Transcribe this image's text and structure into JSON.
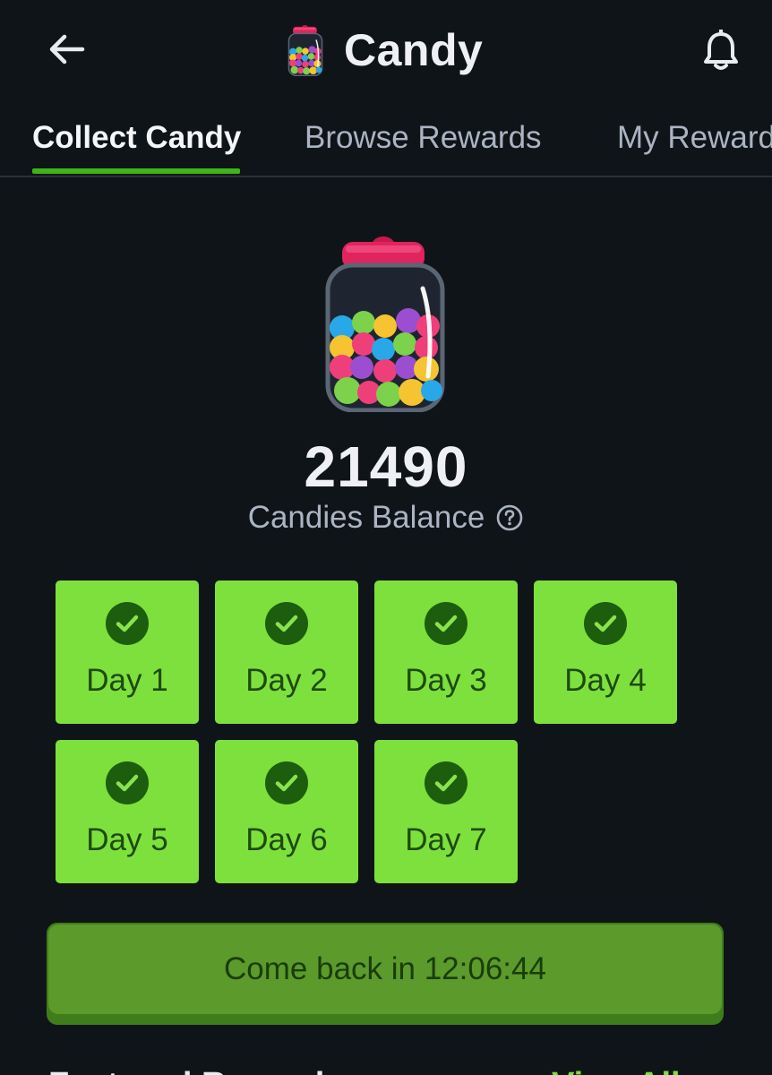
{
  "header": {
    "title": "Candy",
    "back_icon": "arrow-left-icon",
    "jar_icon": "candy-jar-icon",
    "bell_icon": "bell-icon"
  },
  "tabs": [
    {
      "label": "Collect Candy",
      "active": true
    },
    {
      "label": "Browse Rewards",
      "active": false
    },
    {
      "label": "My Rewards",
      "active": false
    }
  ],
  "balance": {
    "value": "21490",
    "label": "Candies Balance",
    "help_icon": "question-circle-icon"
  },
  "days": [
    {
      "label": "Day 1",
      "completed": true
    },
    {
      "label": "Day 2",
      "completed": true
    },
    {
      "label": "Day 3",
      "completed": true
    },
    {
      "label": "Day 4",
      "completed": true
    },
    {
      "label": "Day 5",
      "completed": true
    },
    {
      "label": "Day 6",
      "completed": true
    },
    {
      "label": "Day 7",
      "completed": true
    }
  ],
  "collect_button": {
    "label": "Come back in 12:06:44"
  },
  "section": {
    "title": "Featured Rewards",
    "link": "View All"
  },
  "colors": {
    "background": "#0f1419",
    "accent_green": "#7ee03c",
    "tab_underline": "#3cb516",
    "button_green": "#5b9a2b",
    "jar_lid": "#e0245e"
  }
}
